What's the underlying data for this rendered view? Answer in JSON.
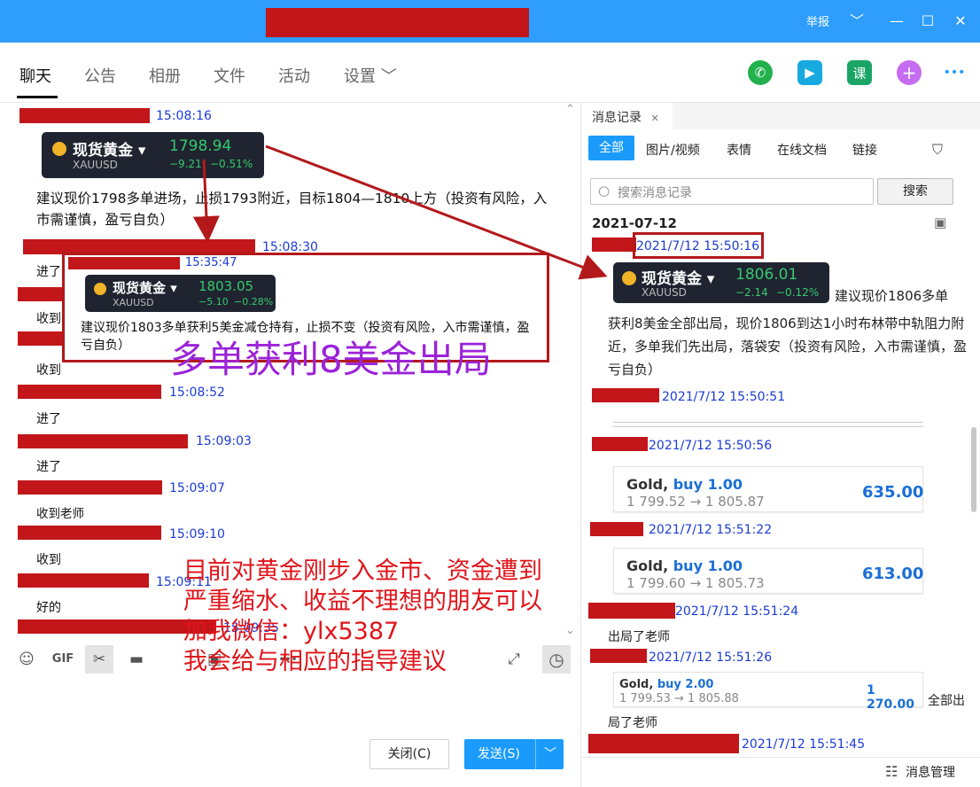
{
  "titlebar": {
    "report": "举报",
    "minimize": "﹀",
    "min": "—",
    "max": "☐",
    "close": "✕"
  },
  "nav": {
    "tabs": [
      "聊天",
      "公告",
      "相册",
      "文件",
      "活动",
      "设置 ﹀"
    ],
    "tools": {
      "call": "✆",
      "video": "▶",
      "lesson": "课",
      "add": "+",
      "more": "•••"
    }
  },
  "chat": {
    "times": [
      "15:08:16",
      "15:08:30",
      "15:35:47",
      "15:08:52",
      "15:09:03",
      "15:09:07",
      "15:09:10",
      "15:09:11",
      "15:09:35"
    ],
    "quote1": {
      "name": "现货黄金 ▾",
      "symbol": "XAUUSD",
      "price": "1798.94",
      "change": "−9.21",
      "pct": "−0.51%"
    },
    "msg1": "建议现价1798多单进场，止损1793附近，目标1804—1810上方（投资有风险，入市需谨慎，盈亏自负）",
    "quote2": {
      "name": "现货黄金 ▾",
      "symbol": "XAUUSD",
      "price": "1803.05",
      "change": "−5.10",
      "pct": "−0.28%"
    },
    "msg2": "建议现价1803多单获利5美金减仓持有，止损不变（投资有风险，入市需谨慎，盈亏自负）",
    "replies": [
      "进了",
      "收到",
      "收到",
      "进了",
      "进了",
      "收到老师",
      "收到",
      "好的"
    ]
  },
  "toolbar": {
    "emoji": "☺",
    "gif": "GIF",
    "scissors": "✂",
    "folder": "▬",
    "image": "▣",
    "more": "•••",
    "expand": "⤢",
    "clock": "◷"
  },
  "buttons": {
    "close": "关闭(C)",
    "send": "发送(S)",
    "send_menu": "﹀"
  },
  "history": {
    "tab": "消息记录",
    "tab_close": "✕",
    "filters": [
      "全部",
      "图片/视频",
      "表情",
      "在线文档",
      "链接"
    ],
    "search_placeholder": "搜索消息记录",
    "search_button": "搜索",
    "date": "2021-07-12",
    "times": [
      "2021/7/12 15:50:16",
      "2021/7/12 15:50:51",
      "2021/7/12 15:50:56",
      "2021/7/12 15:51:22",
      "2021/7/12 15:51:24",
      "2021/7/12 15:51:26",
      "2021/7/12 15:51:45"
    ],
    "quote": {
      "name": "现货黄金 ▾",
      "symbol": "XAUUSD",
      "price": "1806.01",
      "change": "−2.14",
      "pct": "−0.12%"
    },
    "msg_inline": "建议现价1806多单",
    "msg_rest": "获利8美金全部出局，现价1806到达1小时布林带中轨阻力附近，多单我们先出局，落袋安（投资有风险，入市需谨慎，盈亏自负）",
    "trades": [
      {
        "label": "Gold,",
        "side": "buy 1.00",
        "range": "1 799.52 → 1 805.87",
        "amount": "635.00"
      },
      {
        "label": "Gold,",
        "side": "buy 1.00",
        "range": "1 799.60 → 1 805.73",
        "amount": "613.00"
      },
      {
        "label": "Gold,",
        "side": "buy 2.00",
        "range": "1 799.53 → 1 805.88",
        "amount": "1 270.00"
      }
    ],
    "reply1": "出局了老师",
    "reply2_a": "全部出",
    "reply2_b": "局了老师",
    "manage": "消息管理"
  },
  "overlays": {
    "purple": "多单获利8美金出局",
    "red_lines": [
      "目前对黄金刚步入金市、资金遭到",
      "严重缩水、收益不理想的朋友可以",
      "加我微信：ylx5387",
      "我会给与相应的指导建议"
    ]
  },
  "colors": {
    "titlebar": "#2e9dfb",
    "redact": "#c2161b",
    "timestamp": "#1b3bd6",
    "accent": "#1a9bfc",
    "overlay_red": "#e0141a",
    "overlay_purple": "#9b23d8"
  }
}
